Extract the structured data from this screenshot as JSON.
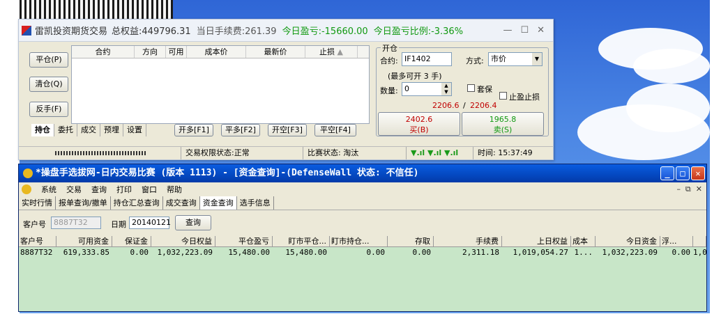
{
  "trade_window": {
    "title": "雷凯投资期货交易",
    "total_equity": "总权益:449796.31",
    "today_fee": "当日手续费:261.39",
    "today_pl": "今日盈亏:-15660.00",
    "today_pl_ratio": "今日盈亏比例:-3.36%",
    "columns": [
      "合约",
      "方向",
      "可用",
      "成本价",
      "最新价",
      "止损"
    ],
    "buttons": {
      "close": "平仓(P)",
      "clear": "清仓(Q)",
      "reverse": "反手(F)"
    },
    "tabs": [
      "持仓",
      "委托",
      "成交",
      "预埋",
      "设置"
    ],
    "hotkeys": [
      "开多[F1]",
      "平多[F2]",
      "开空[F3]",
      "平空[F4]"
    ],
    "open": {
      "group_label": "开仓",
      "contract_label": "合约:",
      "contract_value": "IF1402",
      "method_label": "方式:",
      "method_value": "市价",
      "max_hint": "(最多可开 3 手)",
      "qty_label": "数量:",
      "qty_value": "0",
      "hedge_label": "套保",
      "stop_label": "止盈止损",
      "price_bid": "2206.6",
      "price_sep": "/",
      "price_ask": "2206.4",
      "buy_price": "2402.6",
      "buy_label": "买(B)",
      "sell_price": "1965.8",
      "sell_label": "卖(S)"
    },
    "status": {
      "perm": "交易权限状态:正常",
      "contest": "比赛状态: 淘汰",
      "time": "时间: 15:37:49"
    },
    "colors": {
      "up": "#c00000",
      "down": "#119911"
    }
  },
  "client_window": {
    "title": "*操盘手选拔网-日内交易比赛  (版本 1113) - [资金查询]-(DefenseWall 状态: 不信任)",
    "menu": [
      "系统",
      "交易",
      "查询",
      "打印",
      "窗口",
      "帮助"
    ],
    "tabs": [
      "实时行情",
      "报单查询/撤单",
      "持仓汇总查询",
      "成交查询",
      "资金查询",
      "选手信息"
    ],
    "client_label": "客户号",
    "client_value": "8887T32",
    "date_label": "日期",
    "date_value": "20140121",
    "query_button": "查询",
    "headers": [
      "客户号",
      "可用资金",
      "保证金",
      "今日权益",
      "平仓盈亏",
      "盯市平仓...",
      "盯市持仓...",
      "存取",
      "手续费",
      "上日权益",
      "成本",
      "今日资金",
      "浮...",
      ""
    ],
    "rows": [
      [
        "8887T32",
        "619,333.85",
        "0.00",
        "1,032,223.09",
        "15,480.00",
        "15,480.00",
        "0.00",
        "0.00",
        "2,311.18",
        "1,019,054.27",
        "1...",
        "1,032,223.09",
        "0.00",
        "1,0"
      ]
    ]
  }
}
